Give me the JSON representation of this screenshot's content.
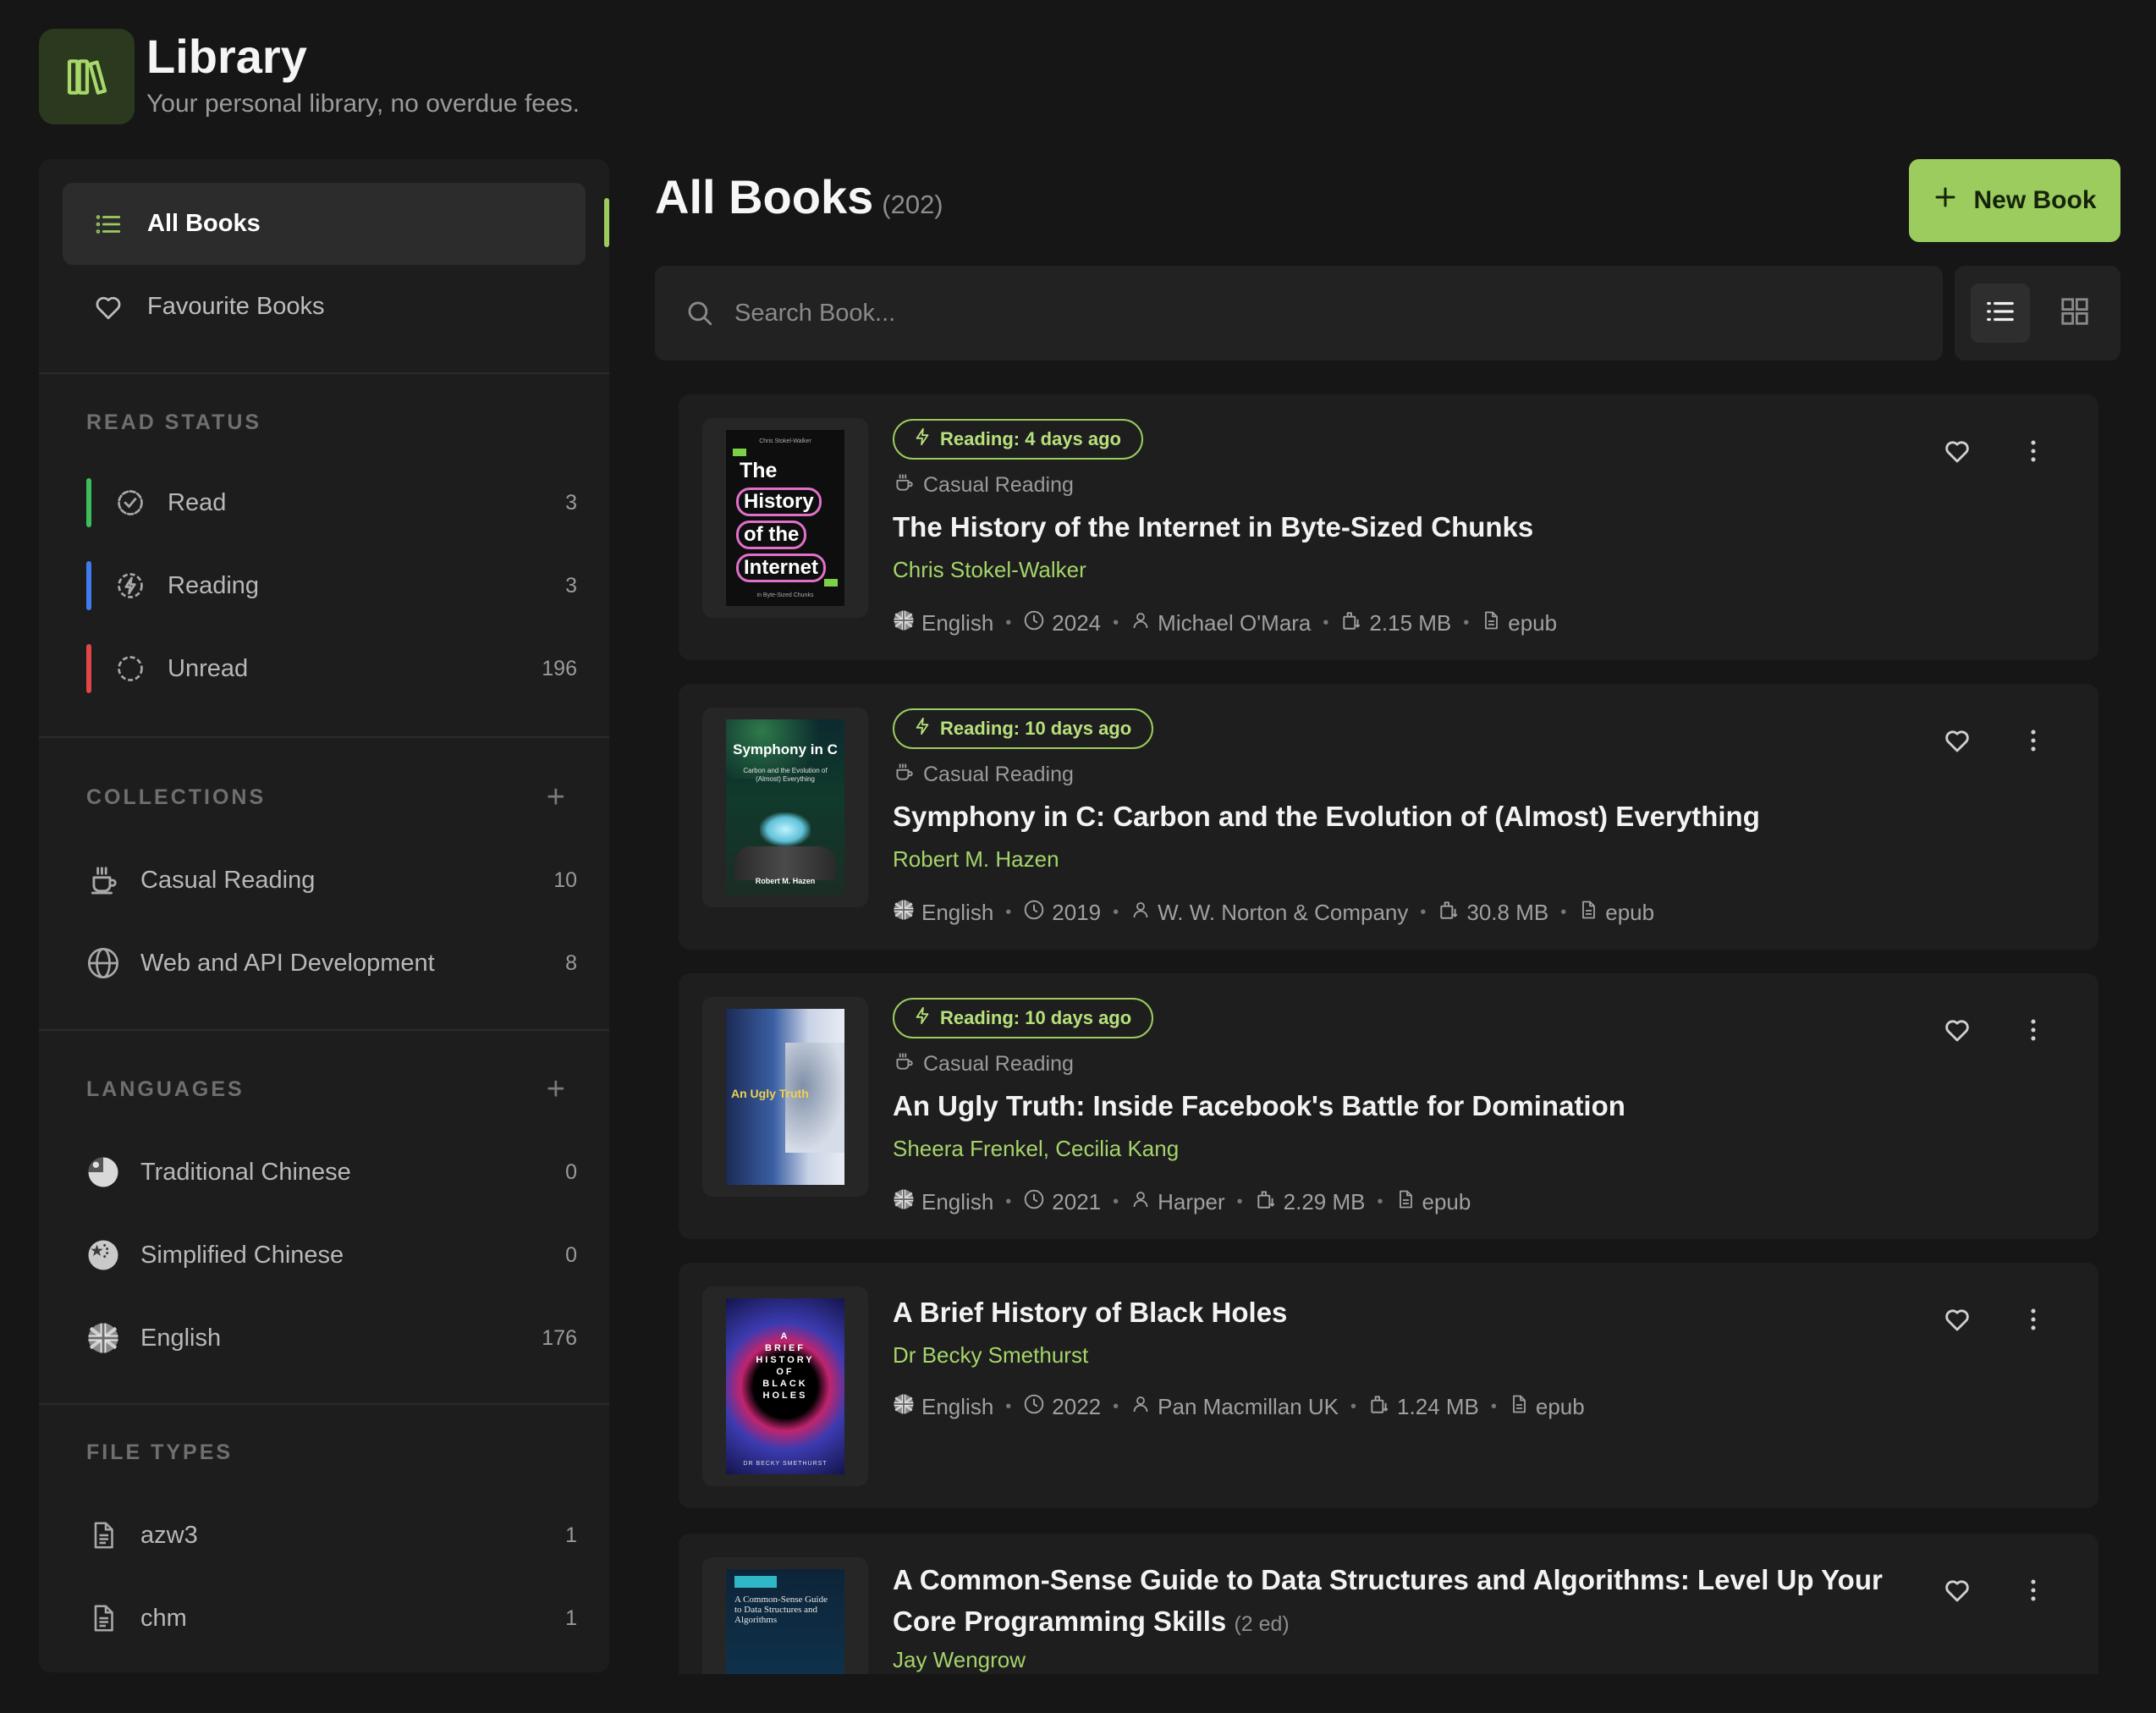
{
  "header": {
    "title": "Library",
    "subtitle": "Your personal library, no overdue fees."
  },
  "sidebar": {
    "nav": [
      {
        "label": "All Books",
        "icon": "list-icon",
        "active": true
      },
      {
        "label": "Favourite Books",
        "icon": "heart-icon",
        "active": false
      }
    ],
    "read_status": {
      "title": "READ STATUS",
      "items": [
        {
          "label": "Read",
          "count": "3",
          "color": "#3bbf5c"
        },
        {
          "label": "Reading",
          "count": "3",
          "color": "#3d7df0"
        },
        {
          "label": "Unread",
          "count": "196",
          "color": "#e04646"
        }
      ]
    },
    "collections": {
      "title": "COLLECTIONS",
      "items": [
        {
          "label": "Casual Reading",
          "count": "10",
          "icon": "coffee-cup-icon"
        },
        {
          "label": "Web and API Development",
          "count": "8",
          "icon": "globe-icon"
        }
      ]
    },
    "languages": {
      "title": "LANGUAGES",
      "items": [
        {
          "label": "Traditional Chinese",
          "count": "0",
          "icon": "flag-taiwan-icon"
        },
        {
          "label": "Simplified Chinese",
          "count": "0",
          "icon": "flag-china-icon"
        },
        {
          "label": "English",
          "count": "176",
          "icon": "flag-uk-icon"
        }
      ]
    },
    "file_types": {
      "title": "FILE TYPES",
      "items": [
        {
          "label": "azw3",
          "count": "1",
          "icon": "file-icon"
        },
        {
          "label": "chm",
          "count": "1",
          "icon": "file-icon"
        }
      ]
    }
  },
  "main": {
    "title": "All Books",
    "total": "(202)",
    "new_book_label": "New Book",
    "search_placeholder": "Search Book...",
    "accent": "#9bcc5d",
    "books": [
      {
        "badge": "Reading: 4 days ago",
        "collection": "Casual Reading",
        "title": "The History of the Internet in Byte-Sized Chunks",
        "author": "Chris Stokel-Walker",
        "language": "English",
        "year": "2024",
        "publisher": "Michael O'Mara",
        "size": "2.15 MB",
        "format": "epub",
        "cover": {
          "lines": [
            "The",
            "History",
            "of the",
            "Internet"
          ],
          "top_text": "Chris Stokel-Walker",
          "bottom_text": "in Byte-Sized Chunks"
        }
      },
      {
        "badge": "Reading: 10 days ago",
        "collection": "Casual Reading",
        "title": "Symphony in C: Carbon and the Evolution of (Almost) Everything",
        "author": "Robert M. Hazen",
        "language": "English",
        "year": "2019",
        "publisher": "W. W. Norton & Company",
        "size": "30.8 MB",
        "format": "epub",
        "cover": {
          "title": "Symphony in C",
          "subtitle": "Carbon and the Evolution of (Almost) Everything",
          "author": "Robert M. Hazen"
        }
      },
      {
        "badge": "Reading: 10 days ago",
        "collection": "Casual Reading",
        "title": "An Ugly Truth: Inside Facebook's Battle for Domination",
        "author": "Sheera Frenkel, Cecilia Kang",
        "language": "English",
        "year": "2021",
        "publisher": "Harper",
        "size": "2.29 MB",
        "format": "epub",
        "cover": {
          "title": "An Ugly Truth"
        }
      },
      {
        "title": "A Brief History of Black Holes",
        "author": "Dr Becky Smethurst",
        "language": "English",
        "year": "2022",
        "publisher": "Pan Macmillan UK",
        "size": "1.24 MB",
        "format": "epub",
        "cover": {
          "lines": [
            "A",
            "BRIEF",
            "HISTORY",
            "OF",
            "BLACK",
            "HOLES"
          ],
          "author": "DR BECKY SMETHURST"
        }
      },
      {
        "title": "A Common-Sense Guide to Data Structures and Algorithms: Level Up Your Core Programming Skills",
        "edition": "(2 ed)",
        "author": "Jay Wengrow",
        "cover": {
          "title": "A Common-Sense Guide to Data Structures and Algorithms"
        }
      }
    ]
  }
}
